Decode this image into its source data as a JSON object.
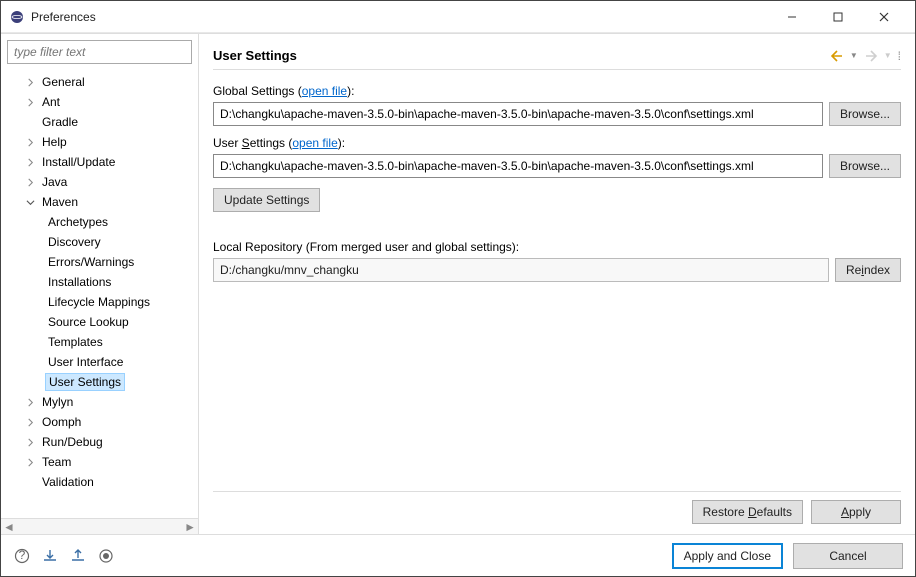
{
  "window": {
    "title": "Preferences"
  },
  "filter": {
    "placeholder": "type filter text"
  },
  "tree": {
    "general": "General",
    "ant": "Ant",
    "gradle": "Gradle",
    "help": "Help",
    "install": "Install/Update",
    "java": "Java",
    "maven": "Maven",
    "maven_children": {
      "archetypes": "Archetypes",
      "discovery": "Discovery",
      "errors": "Errors/Warnings",
      "installations": "Installations",
      "lifecycle": "Lifecycle Mappings",
      "source": "Source Lookup",
      "templates": "Templates",
      "ui": "User Interface",
      "settings": "User Settings"
    },
    "mylyn": "Mylyn",
    "oomph": "Oomph",
    "rundebug": "Run/Debug",
    "team": "Team",
    "validation": "Validation"
  },
  "page": {
    "title": "User Settings",
    "global_prefix": "Global Settings (",
    "global_link": "open file",
    "global_suffix": "):",
    "global_value": "D:\\changku\\apache-maven-3.5.0-bin\\apache-maven-3.5.0-bin\\apache-maven-3.5.0\\conf\\settings.xml",
    "user_label_pre": "User ",
    "user_label_u": "S",
    "user_label_post": "ettings (",
    "user_link": "open file",
    "user_suffix": "):",
    "user_value": "D:\\changku\\apache-maven-3.5.0-bin\\apache-maven-3.5.0-bin\\apache-maven-3.5.0\\conf\\settings.xml",
    "update": "Update Settings",
    "local_repo_label": "Local Repository (From merged user and global settings):",
    "local_repo_value": "D:/changku/mnv_changku",
    "browse": "Browse...",
    "reindex_pre": "Re",
    "reindex_u": "i",
    "reindex_post": "ndex",
    "restore_pre": "Restore ",
    "restore_u": "D",
    "restore_post": "efaults",
    "apply_pre": "",
    "apply_u": "A",
    "apply_post": "pply",
    "apply_close": "Apply and Close",
    "cancel": "Cancel"
  }
}
